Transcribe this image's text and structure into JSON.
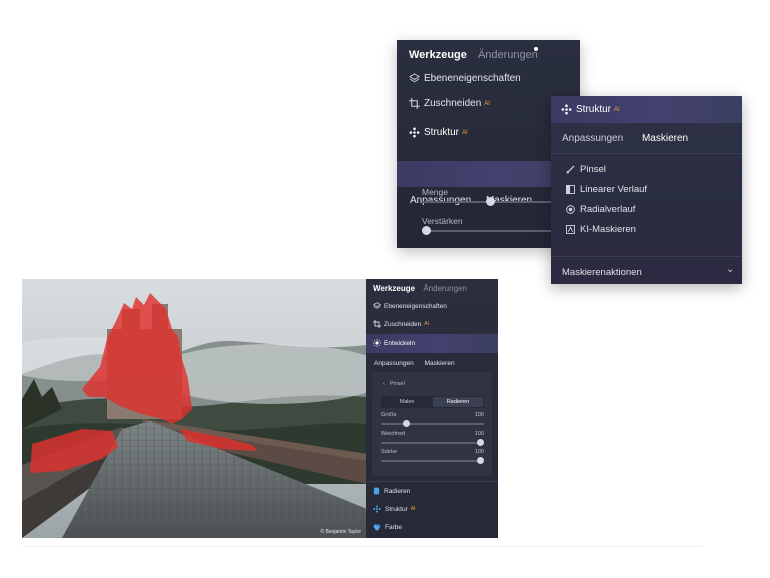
{
  "panel_top_left": {
    "tab_active": "Werkzeuge",
    "tab_inactive": "Änderungen",
    "items": [
      {
        "label": "Ebeneneigenschaften",
        "icon": "layers-icon"
      },
      {
        "label": "Zuschneiden",
        "badge": "AI",
        "icon": "crop-icon"
      }
    ],
    "selected_tool": {
      "label": "Struktur",
      "badge": "AI",
      "icon": "structure-icon"
    },
    "subtabs": [
      "Anpassungen",
      "Maskieren"
    ],
    "sliders": [
      {
        "label": "Menge",
        "value": 0.52
      },
      {
        "label": "Verstärken",
        "value": 0.0
      }
    ]
  },
  "panel_top_right": {
    "title": "Struktur",
    "badge": "AI",
    "tabs": [
      "Anpassungen",
      "Maskieren"
    ],
    "active_tab": "Maskieren",
    "mask_tools": [
      {
        "label": "Pinsel",
        "icon": "brush-icon"
      },
      {
        "label": "Linearer Verlauf",
        "icon": "linear-gradient-icon"
      },
      {
        "label": "Radialverlauf",
        "icon": "radial-gradient-icon"
      },
      {
        "label": "KI-Maskieren",
        "icon": "ai-mask-icon"
      }
    ],
    "actions_label": "Maskierenaktionen"
  },
  "photo": {
    "credit": "© Benjamin Taylor"
  },
  "panel_bottom": {
    "tab_active": "Werkzeuge",
    "tab_inactive": "Änderungen",
    "items": [
      {
        "label": "Ebeneneigenschaften",
        "icon": "layers-icon"
      },
      {
        "label": "Zuschneiden",
        "badge": "AI",
        "icon": "crop-icon"
      }
    ],
    "selected_tool": {
      "label": "Entwickeln",
      "icon": "sun-icon"
    },
    "subtabs": [
      "Anpassungen",
      "Maskieren"
    ],
    "back_label": "Pinsel",
    "segment": [
      "Malen",
      "Radieren"
    ],
    "active_segment": "Radieren",
    "sliders": [
      {
        "label": "Größe",
        "value_text": "100",
        "value": 0.25
      },
      {
        "label": "Weichheit",
        "value_text": "100",
        "value": 1.0
      },
      {
        "label": "Stärke",
        "value_text": "100",
        "value": 1.0
      }
    ],
    "tools": [
      {
        "label": "Radieren",
        "icon": "eraser-icon"
      },
      {
        "label": "Struktur",
        "badge": "AI",
        "icon": "structure-icon"
      },
      {
        "label": "Farbe",
        "icon": "color-icon"
      }
    ]
  },
  "colors": {
    "mask_overlay": "#e0312e",
    "panel_bg": "#282c3b",
    "selected_band": "#40406a",
    "ai_badge": "#f3a63a"
  }
}
